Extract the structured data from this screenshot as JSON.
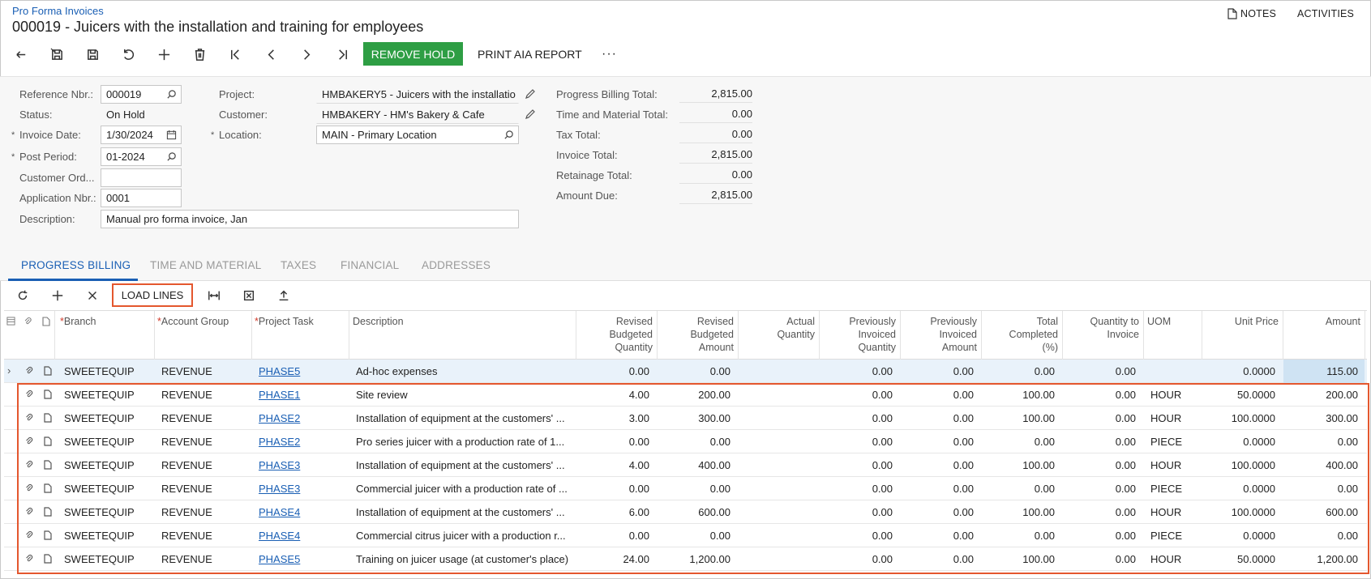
{
  "breadcrumb": "Pro Forma Invoices",
  "title": "000019 - Juicers with the installation and training for employees",
  "top_right": {
    "notes": "NOTES",
    "activities": "ACTIVITIES"
  },
  "toolbar": {
    "remove_hold": "REMOVE HOLD",
    "print_aia": "PRINT AIA REPORT",
    "more": "···",
    "icons": [
      "undo-icon",
      "save-close-icon",
      "save-icon",
      "cancel-icon",
      "add-icon",
      "delete-icon",
      "first-icon",
      "prev-icon",
      "next-icon",
      "last-icon"
    ]
  },
  "form": {
    "reference_nbr": {
      "label": "Reference Nbr.:",
      "value": "000019"
    },
    "status": {
      "label": "Status:",
      "value": "On Hold"
    },
    "invoice_date": {
      "label": "Invoice Date:",
      "value": "1/30/2024"
    },
    "post_period": {
      "label": "Post Period:",
      "value": "01-2024"
    },
    "customer_ord": {
      "label": "Customer Ord...",
      "value": ""
    },
    "application_nbr": {
      "label": "Application Nbr.:",
      "value": "0001"
    },
    "description": {
      "label": "Description:",
      "value": "Manual pro forma invoice, Jan"
    },
    "project": {
      "label": "Project:",
      "value": "HMBAKERY5 - Juicers with the installatio"
    },
    "customer": {
      "label": "Customer:",
      "value": "HMBAKERY - HM's Bakery & Cafe"
    },
    "location": {
      "label": "Location:",
      "value": "MAIN - Primary Location"
    }
  },
  "totals": {
    "progress_billing": {
      "label": "Progress Billing Total:",
      "value": "2,815.00"
    },
    "time_material": {
      "label": "Time and Material Total:",
      "value": "0.00"
    },
    "tax": {
      "label": "Tax Total:",
      "value": "0.00"
    },
    "invoice": {
      "label": "Invoice Total:",
      "value": "2,815.00"
    },
    "retainage": {
      "label": "Retainage Total:",
      "value": "0.00"
    },
    "amount_due": {
      "label": "Amount Due:",
      "value": "2,815.00"
    }
  },
  "tabs": [
    "PROGRESS BILLING",
    "TIME AND MATERIAL",
    "TAXES",
    "FINANCIAL",
    "ADDRESSES"
  ],
  "grid_toolbar": {
    "load_lines": "LOAD LINES"
  },
  "columns": {
    "branch": "Branch",
    "account_group": "Account Group",
    "project_task": "Project Task",
    "description": "Description",
    "rev_bud_qty": [
      "Revised",
      "Budgeted",
      "Quantity"
    ],
    "rev_bud_amt": [
      "Revised",
      "Budgeted",
      "Amount"
    ],
    "actual_qty": [
      "Actual",
      "Quantity"
    ],
    "prev_inv_qty": [
      "Previously",
      "Invoiced",
      "Quantity"
    ],
    "prev_inv_amt": [
      "Previously",
      "Invoiced",
      "Amount"
    ],
    "total_completed": [
      "Total",
      "Completed",
      "(%)"
    ],
    "qty_to_invoice": [
      "Quantity to",
      "Invoice"
    ],
    "uom": "UOM",
    "unit_price": "Unit Price",
    "amount": "Amount"
  },
  "rows": [
    {
      "branch": "SWEETEQUIP",
      "account_group": "REVENUE",
      "task": "PHASE5",
      "description": "Ad-hoc expenses",
      "rbq": "0.00",
      "rba": "0.00",
      "actual": "",
      "piq": "0.00",
      "pia": "0.00",
      "tc": "0.00",
      "qti": "0.00",
      "uom": "",
      "unit_price": "0.0000",
      "amount": "115.00"
    },
    {
      "branch": "SWEETEQUIP",
      "account_group": "REVENUE",
      "task": "PHASE1",
      "description": "Site review",
      "rbq": "4.00",
      "rba": "200.00",
      "actual": "",
      "piq": "0.00",
      "pia": "0.00",
      "tc": "100.00",
      "qti": "0.00",
      "uom": "HOUR",
      "unit_price": "50.0000",
      "amount": "200.00"
    },
    {
      "branch": "SWEETEQUIP",
      "account_group": "REVENUE",
      "task": "PHASE2",
      "description": "Installation of equipment at the customers' ...",
      "rbq": "3.00",
      "rba": "300.00",
      "actual": "",
      "piq": "0.00",
      "pia": "0.00",
      "tc": "100.00",
      "qti": "0.00",
      "uom": "HOUR",
      "unit_price": "100.0000",
      "amount": "300.00"
    },
    {
      "branch": "SWEETEQUIP",
      "account_group": "REVENUE",
      "task": "PHASE2",
      "description": "Pro series juicer with a production rate of 1...",
      "rbq": "0.00",
      "rba": "0.00",
      "actual": "",
      "piq": "0.00",
      "pia": "0.00",
      "tc": "0.00",
      "qti": "0.00",
      "uom": "PIECE",
      "unit_price": "0.0000",
      "amount": "0.00"
    },
    {
      "branch": "SWEETEQUIP",
      "account_group": "REVENUE",
      "task": "PHASE3",
      "description": "Installation of equipment at the customers' ...",
      "rbq": "4.00",
      "rba": "400.00",
      "actual": "",
      "piq": "0.00",
      "pia": "0.00",
      "tc": "100.00",
      "qti": "0.00",
      "uom": "HOUR",
      "unit_price": "100.0000",
      "amount": "400.00"
    },
    {
      "branch": "SWEETEQUIP",
      "account_group": "REVENUE",
      "task": "PHASE3",
      "description": "Commercial juicer with a production rate of ...",
      "rbq": "0.00",
      "rba": "0.00",
      "actual": "",
      "piq": "0.00",
      "pia": "0.00",
      "tc": "0.00",
      "qti": "0.00",
      "uom": "PIECE",
      "unit_price": "0.0000",
      "amount": "0.00"
    },
    {
      "branch": "SWEETEQUIP",
      "account_group": "REVENUE",
      "task": "PHASE4",
      "description": "Installation of equipment at the customers' ...",
      "rbq": "6.00",
      "rba": "600.00",
      "actual": "",
      "piq": "0.00",
      "pia": "0.00",
      "tc": "100.00",
      "qti": "0.00",
      "uom": "HOUR",
      "unit_price": "100.0000",
      "amount": "600.00"
    },
    {
      "branch": "SWEETEQUIP",
      "account_group": "REVENUE",
      "task": "PHASE4",
      "description": "Commercial citrus juicer with a production r...",
      "rbq": "0.00",
      "rba": "0.00",
      "actual": "",
      "piq": "0.00",
      "pia": "0.00",
      "tc": "0.00",
      "qti": "0.00",
      "uom": "PIECE",
      "unit_price": "0.0000",
      "amount": "0.00"
    },
    {
      "branch": "SWEETEQUIP",
      "account_group": "REVENUE",
      "task": "PHASE5",
      "description": "Training on juicer usage (at customer's place)",
      "rbq": "24.00",
      "rba": "1,200.00",
      "actual": "",
      "piq": "0.00",
      "pia": "0.00",
      "tc": "100.00",
      "qti": "0.00",
      "uom": "HOUR",
      "unit_price": "50.0000",
      "amount": "1,200.00"
    }
  ]
}
